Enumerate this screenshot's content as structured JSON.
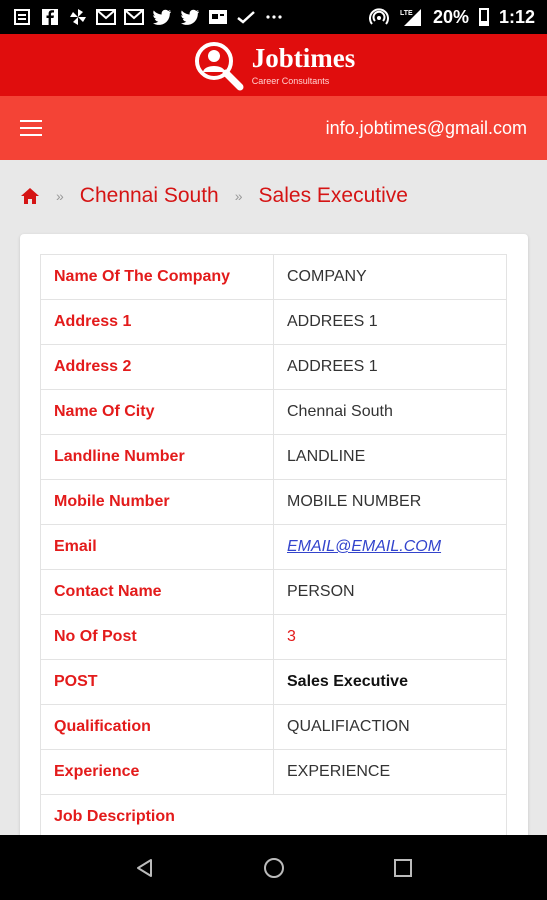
{
  "status_bar": {
    "battery": "20%",
    "time": "1:12",
    "icons": [
      "notes-icon",
      "facebook-icon",
      "pinwheel-icon",
      "mail-icon",
      "mail-icon",
      "twitter-icon",
      "twitter-icon",
      "card-icon",
      "check-icon",
      "more-icon",
      "hotspot-icon",
      "signal-icon",
      "battery-icon"
    ],
    "lte_label": "LTE"
  },
  "brand": {
    "title": "Jobtimes",
    "subtitle": "Career Consultants"
  },
  "navbar": {
    "email": "info.jobtimes@gmail.com"
  },
  "breadcrumb": {
    "items": [
      "Chennai South",
      "Sales Executive"
    ],
    "separator": "»"
  },
  "details": {
    "rows": [
      {
        "label": "Name Of The Company",
        "value": "COMPANY"
      },
      {
        "label": "Address 1",
        "value": "ADDREES 1"
      },
      {
        "label": "Address 2",
        "value": "ADDREES 1"
      },
      {
        "label": "Name Of City",
        "value": "Chennai South"
      },
      {
        "label": "Landline Number",
        "value": "LANDLINE"
      },
      {
        "label": "Mobile Number",
        "value": "MOBILE NUMBER"
      },
      {
        "label": "Email",
        "value": "EMAIL@EMAIL.COM"
      },
      {
        "label": "Contact Name",
        "value": "PERSON"
      },
      {
        "label": "No Of Post",
        "value": "3"
      },
      {
        "label": "POST",
        "value": "Sales Executive"
      },
      {
        "label": "Qualification",
        "value": "QUALIFIACTION"
      },
      {
        "label": "Experience",
        "value": "EXPERIENCE"
      },
      {
        "label": "Job Description",
        "value": ""
      }
    ]
  },
  "colors": {
    "brand_red": "#e00d0d",
    "nav_red": "#f44336",
    "label_red": "#e31b1b",
    "link_blue": "#3344cc"
  }
}
